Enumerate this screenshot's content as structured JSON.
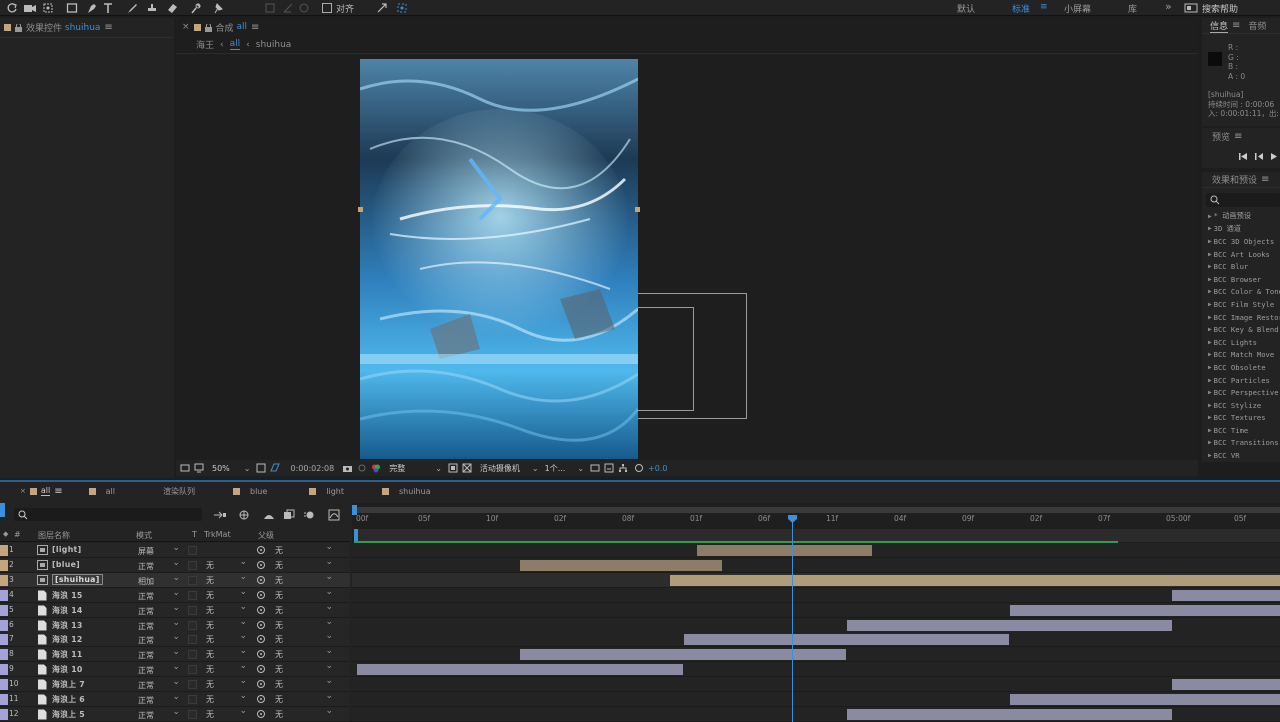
{
  "toolbar": {
    "align_label": "对齐",
    "workspaces": [
      "默认",
      "标准",
      "小屏幕",
      "库"
    ],
    "active_workspace": "标准",
    "more_label": "»",
    "search_help": "搜索帮助"
  },
  "effect_controls": {
    "title": "效果控件",
    "layer": "shuihua"
  },
  "composition": {
    "title_prefix": "合成",
    "comp_name": "all",
    "breadcrumbs": [
      "海王",
      "all",
      "shuihua"
    ],
    "footer": {
      "zoom": "50%",
      "timecode": "0:00:02:08",
      "quality": "完整",
      "camera": "活动摄像机",
      "views": "1个...",
      "exposure": "+0.0"
    }
  },
  "info_panel": {
    "tab_info": "信息",
    "tab_audio": "音频",
    "r": "R :",
    "g": "G :",
    "b": "B :",
    "a": "A : 0",
    "layer_name": "[shuihua]",
    "duration": "持续时间 : 0:00:06",
    "in_out": "入: 0:00:01:11，出:"
  },
  "preview_panel": {
    "title": "预览"
  },
  "effects_presets": {
    "title": "效果和预设",
    "items": [
      "* 动画预设",
      "3D 通道",
      "BCC 3D Objects",
      "BCC Art Looks",
      "BCC Blur",
      "BCC Browser",
      "BCC Color & Tone",
      "BCC Film Style",
      "BCC Image Restore",
      "BCC Key & Blend",
      "BCC Lights",
      "BCC Match Move",
      "BCC Obsolete",
      "BCC Particles",
      "BCC Perspective",
      "BCC Stylize",
      "BCC Textures",
      "BCC Time",
      "BCC Transitions",
      "BCC VR"
    ]
  },
  "timeline": {
    "tabs": [
      "all",
      "all",
      "渲染队列",
      "blue",
      "light",
      "shuihua"
    ],
    "headers": {
      "num": "#",
      "name": "图层名称",
      "mode": "模式",
      "t": "T",
      "trkmat": "TrkMat",
      "parent": "父级"
    },
    "ruler": [
      "00f",
      "05f",
      "10f",
      "02f",
      "08f",
      "01f",
      "06f",
      "11f",
      "04f",
      "09f",
      "02f",
      "07f",
      "05:00f",
      "05f"
    ],
    "layers": [
      {
        "num": "1",
        "name": "[light]",
        "mode": "屏幕",
        "trkmat": "",
        "parent": "无",
        "label": "#c4a57d",
        "icon": "comp"
      },
      {
        "num": "2",
        "name": "[blue]",
        "mode": "正常",
        "trkmat": "无",
        "parent": "无",
        "label": "#c4a57d",
        "icon": "comp"
      },
      {
        "num": "3",
        "name": "[shuihua]",
        "mode": "相加",
        "trkmat": "无",
        "parent": "无",
        "label": "#c4a57d",
        "icon": "comp"
      },
      {
        "num": "4",
        "name": "海浪 15",
        "mode": "正常",
        "trkmat": "无",
        "parent": "无",
        "label": "#a3a3d9",
        "icon": "file"
      },
      {
        "num": "5",
        "name": "海浪 14",
        "mode": "正常",
        "trkmat": "无",
        "parent": "无",
        "label": "#a3a3d9",
        "icon": "file"
      },
      {
        "num": "6",
        "name": "海浪 13",
        "mode": "正常",
        "trkmat": "无",
        "parent": "无",
        "label": "#a3a3d9",
        "icon": "file"
      },
      {
        "num": "7",
        "name": "海浪 12",
        "mode": "正常",
        "trkmat": "无",
        "parent": "无",
        "label": "#a3a3d9",
        "icon": "file"
      },
      {
        "num": "8",
        "name": "海浪 11",
        "mode": "正常",
        "trkmat": "无",
        "parent": "无",
        "label": "#a3a3d9",
        "icon": "file"
      },
      {
        "num": "9",
        "name": "海浪 10",
        "mode": "正常",
        "trkmat": "无",
        "parent": "无",
        "label": "#a3a3d9",
        "icon": "file"
      },
      {
        "num": "10",
        "name": "海浪上 7",
        "mode": "正常",
        "trkmat": "无",
        "parent": "无",
        "label": "#a3a3d9",
        "icon": "file"
      },
      {
        "num": "11",
        "name": "海浪上 6",
        "mode": "正常",
        "trkmat": "无",
        "parent": "无",
        "label": "#a3a3d9",
        "icon": "file"
      },
      {
        "num": "12",
        "name": "海浪上 5",
        "mode": "正常",
        "trkmat": "无",
        "parent": "无",
        "label": "#a3a3d9",
        "icon": "file"
      }
    ]
  },
  "colors": {
    "accent": "#3c8fd9",
    "comp_label": "#c4a57d",
    "footage_label": "#a3a3d9",
    "comp_bar": "#8d7d66",
    "footage_bar": "#8a8aa3",
    "work_area": "#2e9e4a"
  }
}
